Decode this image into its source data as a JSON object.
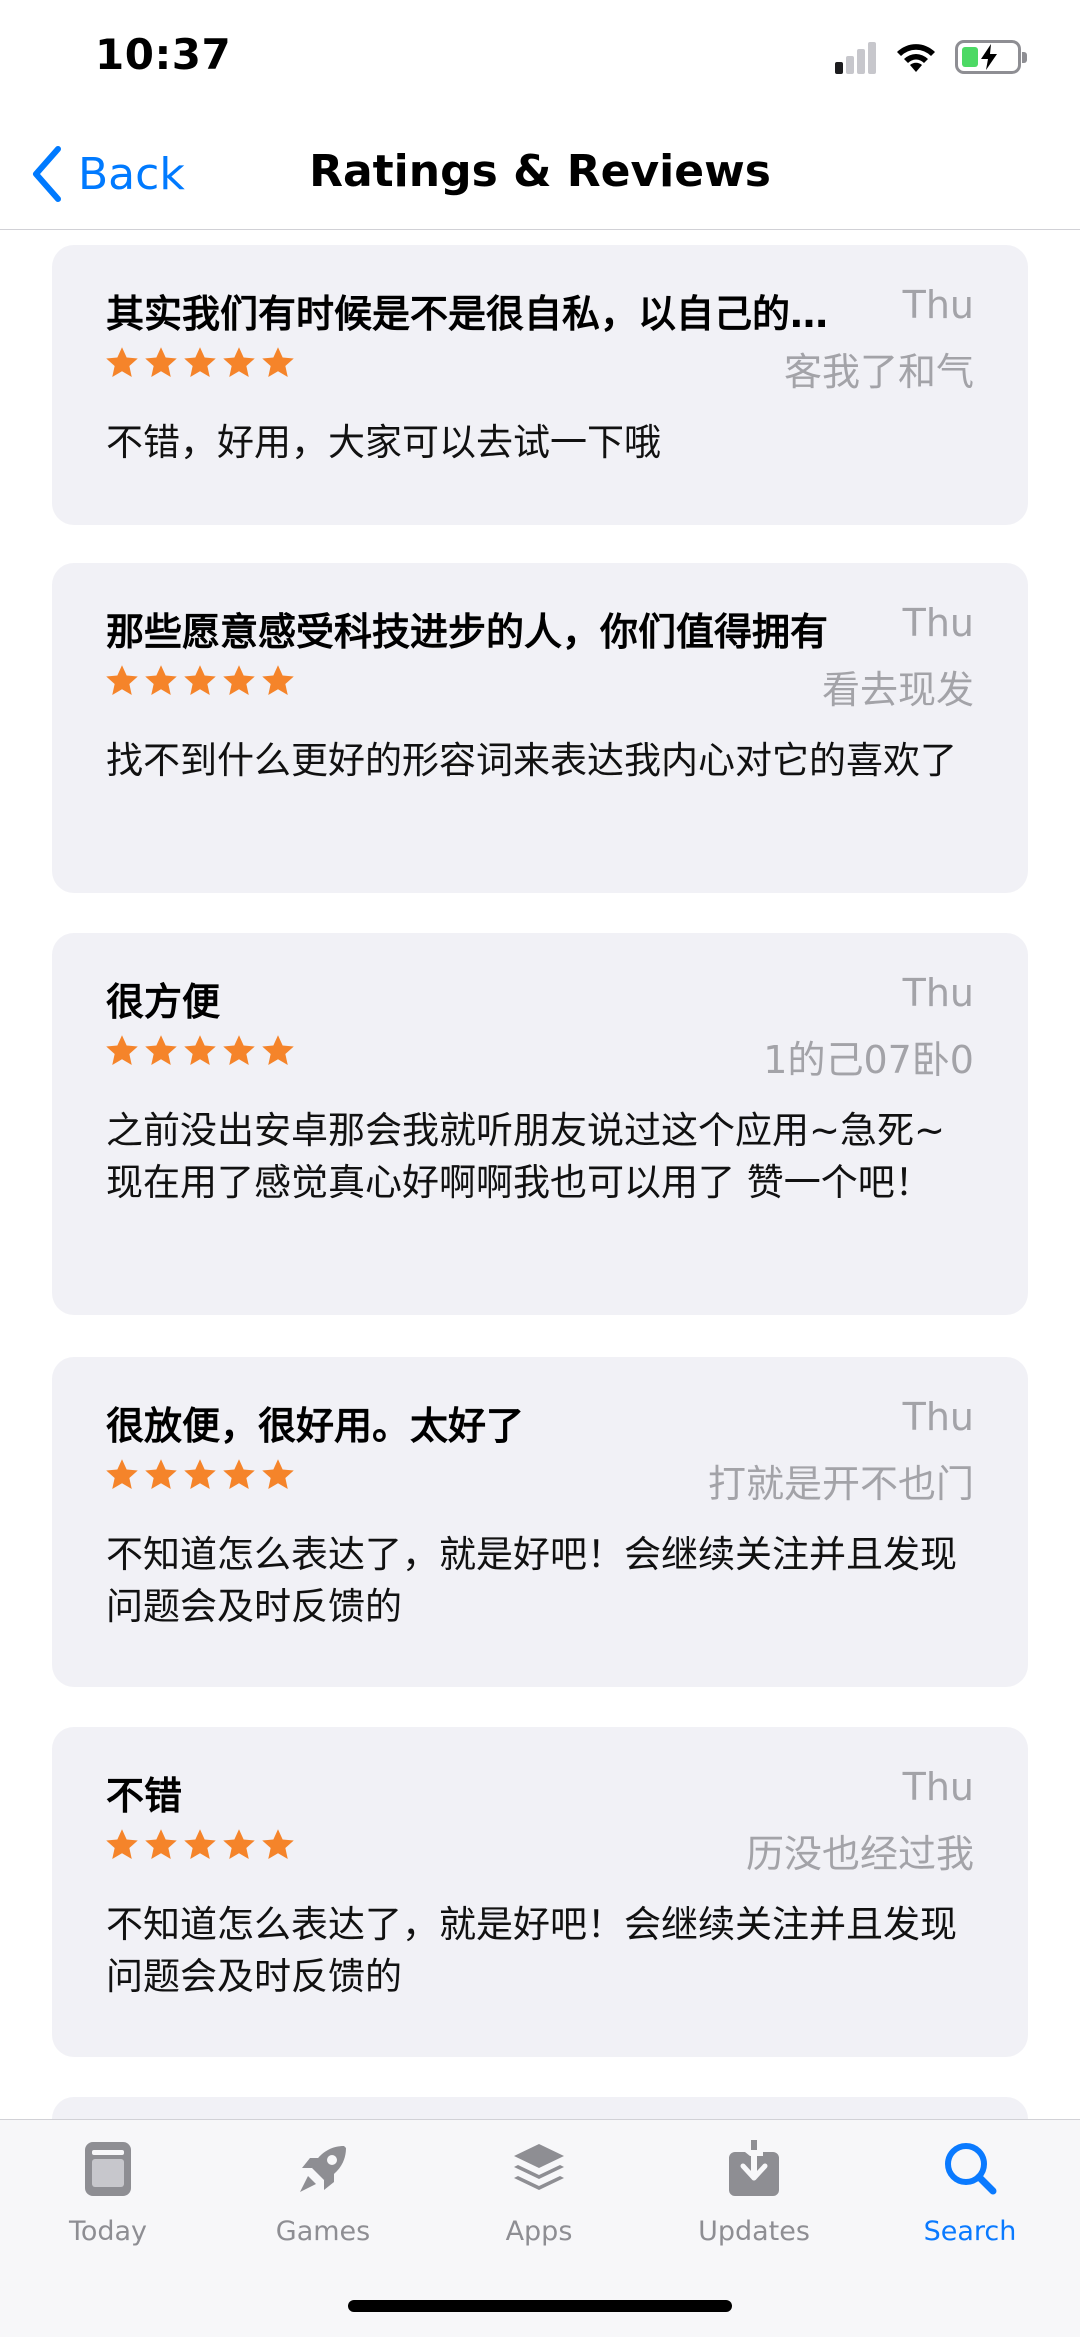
{
  "status_bar": {
    "time": "10:37"
  },
  "nav": {
    "back_label": "Back",
    "title": "Ratings & Reviews"
  },
  "reviews": [
    {
      "title": "其实我们有时候是不是很自私，以自己的…",
      "date": "Thu",
      "author": "客我了和气",
      "rating": 5,
      "body": "不错，好用，大家可以去试一下哦"
    },
    {
      "title": "那些愿意感受科技进步的人，你们值得拥有",
      "date": "Thu",
      "author": "看去现发",
      "rating": 5,
      "body": "找不到什么更好的形容词来表达我内心对它的喜欢了"
    },
    {
      "title": "很方便",
      "date": "Thu",
      "author": "1的己07卧0",
      "rating": 5,
      "body": "之前没出安卓那会我就听朋友说过这个应用~急死~现在用了感觉真心好啊啊我也可以用了 赞一个吧！"
    },
    {
      "title": "很放便，很好用。太好了",
      "date": "Thu",
      "author": "打就是开不也门",
      "rating": 5,
      "body": "不知道怎么表达了，就是好吧！会继续关注并且发现问题会及时反馈的"
    },
    {
      "title": "不错",
      "date": "Thu",
      "author": "历没也经过我",
      "rating": 5,
      "body": "不知道怎么表达了，就是好吧！会继续关注并且发现问题会及时反馈的"
    }
  ],
  "tabs": [
    {
      "label": "Today",
      "icon": "today-icon",
      "active": false
    },
    {
      "label": "Games",
      "icon": "rocket-icon",
      "active": false
    },
    {
      "label": "Apps",
      "icon": "layers-icon",
      "active": false
    },
    {
      "label": "Updates",
      "icon": "download-icon",
      "active": false
    },
    {
      "label": "Search",
      "icon": "search-icon",
      "active": true
    }
  ],
  "colors": {
    "accent": "#007aff",
    "star": "#f5842a",
    "card": "#f1f1f6",
    "secondary_text": "#a3a3a8"
  }
}
